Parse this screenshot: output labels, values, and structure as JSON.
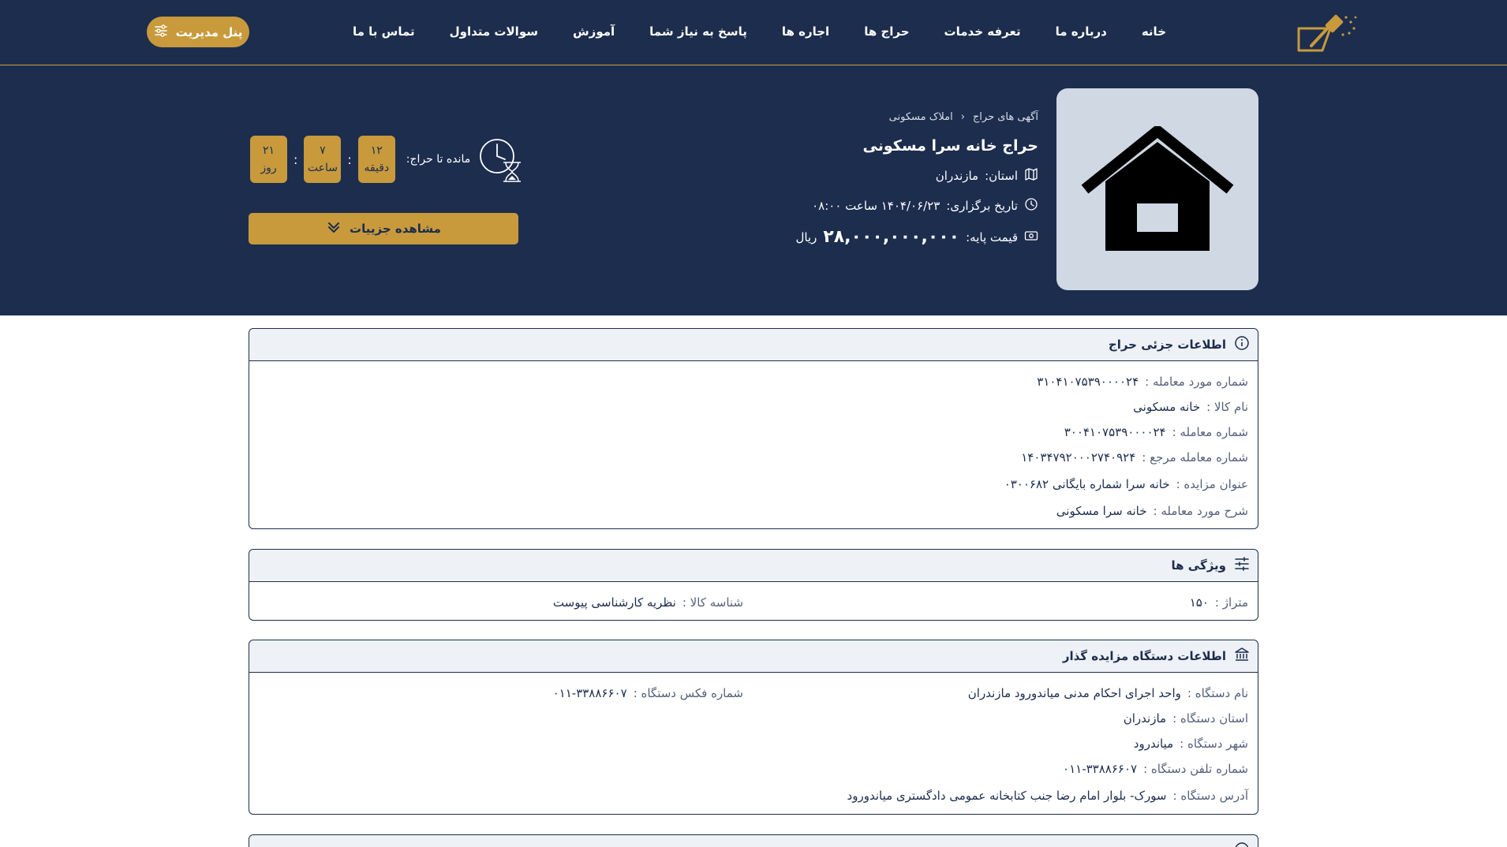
{
  "nav": {
    "items": [
      {
        "label": "خانه"
      },
      {
        "label": "درباره ما"
      },
      {
        "label": "تعرفه خدمات"
      },
      {
        "label": "حراج ها"
      },
      {
        "label": "اجاره ها"
      },
      {
        "label": "پاسخ به نیاز شما"
      },
      {
        "label": "آموزش"
      },
      {
        "label": "سوالات متداول"
      },
      {
        "label": "تماس با ما"
      }
    ],
    "panel_button": "پنل مدیریت"
  },
  "hero": {
    "breadcrumb": [
      "آگهی های حراج",
      "املاک مسکونی"
    ],
    "title": "حراج خانه سرا مسکونی",
    "province_label": "استان:",
    "province_value": "مازندران",
    "date_label": "تاریخ برگزاری:",
    "date_value": "۱۴۰۴/۰۶/۲۳ ساعت ۰۸:۰۰",
    "price_label": "قیمت پایه:",
    "price_value": "۲۸,۰۰۰,۰۰۰,۰۰۰",
    "price_unit": "ریال",
    "countdown_label": "مانده تا حراج:",
    "countdown": [
      {
        "value": "۱۲",
        "unit": "دقیقه"
      },
      {
        "value": "۷",
        "unit": "ساعت"
      },
      {
        "value": "۲۱",
        "unit": "روز"
      }
    ],
    "details_button": "مشاهده جزییات"
  },
  "auction_info": {
    "title": "اطلاعات جزئی حراج",
    "rows": [
      {
        "label": "شماره مورد معامله :",
        "value": "۳۱۰۴۱۰۷۵۳۹۰۰۰۰۲۴"
      },
      {
        "label": "نام کالا :",
        "value": "خانه مسکونی"
      },
      {
        "label": "شماره معامله :",
        "value": "۳۰۰۴۱۰۷۵۳۹۰۰۰۰۲۴"
      },
      {
        "label": "شماره معامله مرجع :",
        "value": "۱۴۰۳۴۷۹۲۰۰۰۲۷۴۰۹۲۴"
      },
      {
        "label": "عنوان مزایده :",
        "value": "خانه سرا شماره بایگانی ۰۳۰۰۶۸۲"
      },
      {
        "label": "شرح مورد معامله :",
        "value": "خانه سرا مسکونی"
      }
    ]
  },
  "features": {
    "title": "ویژگی ها",
    "area_label": "متراژ :",
    "area_value": "۱۵۰",
    "id_label": "شناسه کالا :",
    "id_value": "نظریه کارشناسی پیوست"
  },
  "agency": {
    "title": "اطلاعات دستگاه مزایده گذار",
    "name_label": "نام دستگاه :",
    "name_value": "واحد اجرای احکام مدنی میاندورود مازندران",
    "fax_label": "شماره فکس دستگاه :",
    "fax_value": "۰۱۱-۳۳۸۸۶۶۰۷",
    "province_label": "استان دستگاه :",
    "province_value": "مازندران",
    "city_label": "شهر دستگاه :",
    "city_value": "میاندرود",
    "phone_label": "شماره تلفن دستگاه :",
    "phone_value": "۰۱۱-۳۳۸۸۶۶۰۷",
    "address_label": "آدرس دستگاه :",
    "address_value": "سورک- بلوار امام رضا جنب کتابخانه عمومی دادگستری میاندورود"
  },
  "colors": {
    "navy": "#1c2d4e",
    "gold": "#c89a3c",
    "image_bg": "#cfd8e3",
    "card_head": "#eef1f5"
  }
}
